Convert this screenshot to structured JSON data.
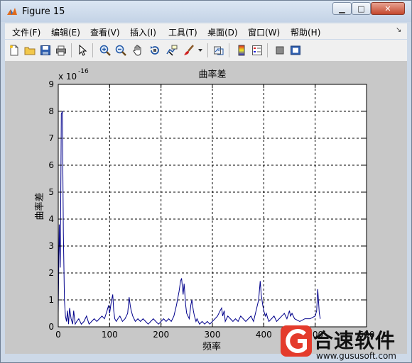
{
  "window": {
    "title": "Figure 15"
  },
  "menu": [
    "文件(F)",
    "编辑(E)",
    "查看(V)",
    "插入(I)",
    "工具(T)",
    "桌面(D)",
    "窗口(W)",
    "帮助(H)"
  ],
  "toolbar_icons": [
    "new-figure-icon",
    "open-file-icon",
    "save-icon",
    "print-icon",
    "arrow-select-icon",
    "zoom-in-icon",
    "zoom-out-icon",
    "pan-hand-icon",
    "rotate-3d-icon",
    "data-cursor-icon",
    "brush-icon",
    "brush-dropdown-icon",
    "link-plot-icon",
    "colorbar-icon",
    "legend-icon",
    "hide-plot-tools-icon",
    "show-plot-tools-icon"
  ],
  "chart_data": {
    "type": "line",
    "title": "曲率差",
    "xlabel": "频率",
    "ylabel": "曲率差",
    "exponent_label": "x 10",
    "exponent_power": "-16",
    "xlim": [
      0,
      600
    ],
    "ylim": [
      0,
      9
    ],
    "xticks": [
      0,
      100,
      200,
      300,
      400,
      500,
      600
    ],
    "yticks": [
      0,
      1,
      2,
      3,
      4,
      5,
      6,
      7,
      8,
      9
    ],
    "grid": true,
    "color": "#00008b",
    "x": [
      0,
      2,
      4,
      6,
      8,
      10,
      12,
      14,
      16,
      18,
      20,
      22,
      25,
      28,
      30,
      33,
      36,
      40,
      45,
      50,
      55,
      60,
      65,
      70,
      75,
      80,
      85,
      90,
      95,
      98,
      100,
      103,
      106,
      108,
      110,
      113,
      116,
      120,
      125,
      130,
      135,
      138,
      140,
      142,
      145,
      150,
      155,
      160,
      165,
      170,
      175,
      180,
      185,
      190,
      195,
      200,
      205,
      210,
      215,
      220,
      225,
      230,
      235,
      238,
      240,
      243,
      245,
      248,
      250,
      255,
      258,
      260,
      263,
      265,
      268,
      270,
      275,
      280,
      285,
      290,
      295,
      300,
      305,
      310,
      315,
      318,
      320,
      323,
      325,
      330,
      335,
      340,
      345,
      350,
      355,
      360,
      365,
      370,
      375,
      380,
      385,
      390,
      393,
      395,
      398,
      400,
      403,
      405,
      408,
      410,
      415,
      420,
      425,
      430,
      435,
      440,
      445,
      450,
      452,
      455,
      460,
      470,
      480,
      490,
      500,
      503,
      505,
      508,
      510
    ],
    "y": [
      0.5,
      3.8,
      2.2,
      7.9,
      8.0,
      3.5,
      1.0,
      0.4,
      0.2,
      0.6,
      0.1,
      0.7,
      0.3,
      0.1,
      0.6,
      0.1,
      0.2,
      0.3,
      0.1,
      0.2,
      0.4,
      0.1,
      0.2,
      0.3,
      0.2,
      0.3,
      0.4,
      0.3,
      0.6,
      0.8,
      0.5,
      0.9,
      1.2,
      0.6,
      0.3,
      0.2,
      0.3,
      0.4,
      0.2,
      0.3,
      0.5,
      1.1,
      0.8,
      0.6,
      0.4,
      0.2,
      0.3,
      0.2,
      0.3,
      0.2,
      0.1,
      0.2,
      0.3,
      0.2,
      0.1,
      0.2,
      0.3,
      0.2,
      0.3,
      0.2,
      0.4,
      0.8,
      1.3,
      1.7,
      1.8,
      1.2,
      1.6,
      0.8,
      0.5,
      0.3,
      0.8,
      1.0,
      0.6,
      0.4,
      0.2,
      0.3,
      0.1,
      0.2,
      0.1,
      0.2,
      0.1,
      0.2,
      0.3,
      0.4,
      0.6,
      0.7,
      0.4,
      0.6,
      0.2,
      0.4,
      0.3,
      0.2,
      0.3,
      0.2,
      0.4,
      0.3,
      0.2,
      0.3,
      0.4,
      0.2,
      0.6,
      1.0,
      1.7,
      1.2,
      0.8,
      0.6,
      0.4,
      0.5,
      0.3,
      0.2,
      0.3,
      0.4,
      0.2,
      0.3,
      0.4,
      0.5,
      0.3,
      0.6,
      0.4,
      0.5,
      0.3,
      0.2,
      0.3,
      0.3,
      0.4,
      0.6,
      1.4,
      0.5,
      0.3
    ]
  },
  "watermark": {
    "brand": "合速软件",
    "url": "www.gususoft.com"
  }
}
